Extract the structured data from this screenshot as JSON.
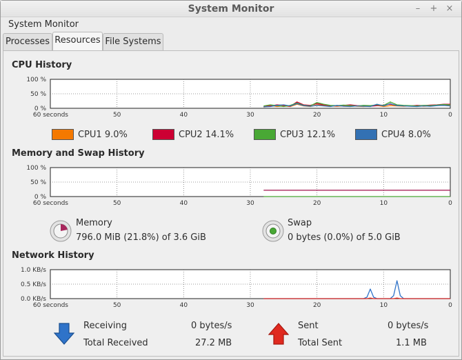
{
  "window": {
    "title": "System Monitor",
    "controls": [
      "–",
      "+",
      "×"
    ]
  },
  "menu": {
    "label": "System Monitor"
  },
  "tabs": [
    {
      "label": "Processes",
      "active": false
    },
    {
      "label": "Resources",
      "active": true
    },
    {
      "label": "File Systems",
      "active": false
    }
  ],
  "cpu": {
    "title": "CPU History",
    "y_ticks": [
      "100 %",
      "50 %",
      "0 %"
    ],
    "x_ticks": [
      "60 seconds",
      "50",
      "40",
      "30",
      "20",
      "10",
      "0"
    ],
    "legend": [
      {
        "name": "CPU1",
        "value": "9.0%",
        "color": "#f57900"
      },
      {
        "name": "CPU2",
        "value": "14.1%",
        "color": "#cc0033"
      },
      {
        "name": "CPU3",
        "value": "12.1%",
        "color": "#49a835"
      },
      {
        "name": "CPU4",
        "value": "8.0%",
        "color": "#3371b3"
      }
    ]
  },
  "memory": {
    "title": "Memory and Swap History",
    "y_ticks": [
      "100 %",
      "50 %",
      "0 %"
    ],
    "x_ticks": [
      "60 seconds",
      "50",
      "40",
      "30",
      "20",
      "10",
      "0"
    ],
    "memory_label": "Memory",
    "memory_value": "796.0 MiB (21.8%) of 3.6 GiB",
    "memory_fraction": 0.218,
    "memory_color": "#a8265c",
    "swap_label": "Swap",
    "swap_value": "0 bytes (0.0%) of 5.0 GiB",
    "swap_fraction": 0.0,
    "swap_color": "#49a835"
  },
  "network": {
    "title": "Network History",
    "y_ticks": [
      "1.0 KB/s",
      "0.5 KB/s",
      "0.0 KB/s"
    ],
    "x_ticks": [
      "60 seconds",
      "50",
      "40",
      "30",
      "20",
      "10",
      "0"
    ],
    "receiving_label": "Receiving",
    "receiving_value": "0 bytes/s",
    "total_received_label": "Total Received",
    "total_received_value": "27.2 MB",
    "sent_label": "Sent",
    "sent_value": "0 bytes/s",
    "total_sent_label": "Total Sent",
    "total_sent_value": "1.1 MB",
    "receive_color": "#2f73c9",
    "send_color": "#e0291f"
  },
  "chart_data": [
    {
      "type": "line",
      "xlabel": "seconds",
      "xlim": [
        60,
        0
      ],
      "ylim": [
        0,
        100
      ],
      "series": [
        {
          "name": "CPU1",
          "x": [
            28,
            27,
            26,
            25,
            24,
            23,
            22,
            21,
            20,
            19,
            18,
            17,
            16,
            15,
            14,
            13,
            12,
            11,
            10,
            9,
            8,
            7,
            6,
            5,
            4,
            3,
            2,
            1,
            0
          ],
          "y": [
            4,
            10,
            6,
            8,
            6,
            14,
            8,
            6,
            12,
            10,
            8,
            7,
            8,
            9,
            7,
            6,
            8,
            10,
            6,
            9,
            8,
            7,
            8,
            9,
            7,
            8,
            10,
            12,
            9
          ]
        },
        {
          "name": "CPU2",
          "x": [
            28,
            27,
            26,
            25,
            24,
            23,
            22,
            21,
            20,
            19,
            18,
            17,
            16,
            15,
            14,
            13,
            12,
            11,
            10,
            9,
            8,
            7,
            6,
            5,
            4,
            3,
            2,
            1,
            0
          ],
          "y": [
            6,
            8,
            12,
            10,
            7,
            22,
            12,
            10,
            16,
            12,
            9,
            8,
            10,
            12,
            9,
            8,
            7,
            9,
            11,
            14,
            10,
            9,
            8,
            10,
            9,
            11,
            12,
            14,
            14
          ]
        },
        {
          "name": "CPU3",
          "x": [
            28,
            27,
            26,
            25,
            24,
            23,
            22,
            21,
            20,
            19,
            18,
            17,
            16,
            15,
            14,
            13,
            12,
            11,
            10,
            9,
            8,
            7,
            6,
            5,
            4,
            3,
            2,
            1,
            0
          ],
          "y": [
            8,
            12,
            9,
            6,
            10,
            18,
            10,
            8,
            20,
            14,
            10,
            9,
            11,
            9,
            8,
            10,
            9,
            12,
            10,
            22,
            12,
            10,
            9,
            8,
            10,
            9,
            11,
            13,
            12
          ]
        },
        {
          "name": "CPU4",
          "x": [
            28,
            27,
            26,
            25,
            24,
            23,
            22,
            21,
            20,
            19,
            18,
            17,
            16,
            15,
            14,
            13,
            12,
            11,
            10,
            9,
            8,
            7,
            6,
            5,
            4,
            3,
            2,
            1,
            0
          ],
          "y": [
            5,
            6,
            10,
            12,
            8,
            16,
            9,
            7,
            10,
            8,
            6,
            10,
            7,
            6,
            8,
            7,
            6,
            14,
            8,
            16,
            9,
            8,
            7,
            6,
            8,
            7,
            9,
            10,
            8
          ]
        }
      ]
    },
    {
      "type": "line",
      "xlabel": "seconds",
      "xlim": [
        60,
        0
      ],
      "ylim": [
        0,
        100
      ],
      "series": [
        {
          "name": "Memory",
          "x": [
            28,
            0
          ],
          "y": [
            21.8,
            21.8
          ]
        },
        {
          "name": "Swap",
          "x": [
            28,
            0
          ],
          "y": [
            0,
            0
          ]
        }
      ]
    },
    {
      "type": "line",
      "xlabel": "seconds",
      "xlim": [
        60,
        0
      ],
      "ylim": [
        0,
        1.0
      ],
      "series": [
        {
          "name": "Receiving",
          "x": [
            28,
            13,
            12.5,
            12,
            11.5,
            11,
            9,
            8.5,
            8,
            7.5,
            7,
            0
          ],
          "y": [
            0,
            0,
            0.05,
            0.33,
            0.05,
            0,
            0,
            0.1,
            0.62,
            0.1,
            0,
            0
          ]
        },
        {
          "name": "Sent",
          "x": [
            28,
            12.5,
            12,
            11.5,
            8.5,
            8,
            7.5,
            0
          ],
          "y": [
            0,
            0,
            0.02,
            0,
            0,
            0.02,
            0,
            0
          ]
        }
      ]
    }
  ]
}
